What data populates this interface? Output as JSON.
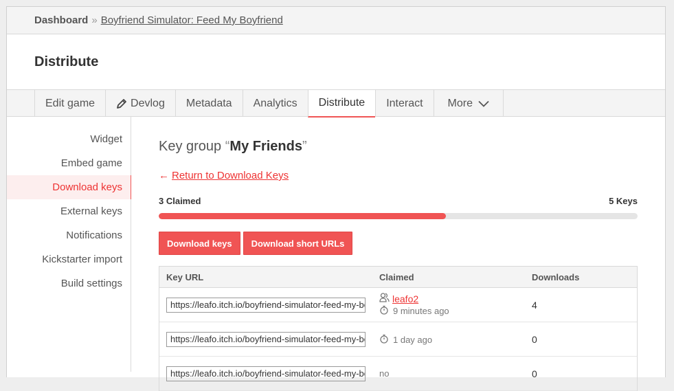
{
  "breadcrumb": {
    "home": "Dashboard",
    "separator": "»",
    "game": "Boyfriend Simulator: Feed My Boyfriend"
  },
  "page_title": "Distribute",
  "tabs": [
    {
      "label": "Edit game"
    },
    {
      "label": "Devlog",
      "icon": "pencil-icon"
    },
    {
      "label": "Metadata"
    },
    {
      "label": "Analytics"
    },
    {
      "label": "Distribute",
      "active": true
    },
    {
      "label": "Interact"
    },
    {
      "label": "More",
      "icon": "chevron-down-icon"
    }
  ],
  "sidebar": {
    "items": [
      {
        "label": "Widget"
      },
      {
        "label": "Embed game"
      },
      {
        "label": "Download keys",
        "active": true
      },
      {
        "label": "External keys"
      },
      {
        "label": "Notifications"
      },
      {
        "label": "Kickstarter import"
      },
      {
        "label": "Build settings"
      }
    ]
  },
  "key_group": {
    "prefix": "Key group",
    "open_quote": "“",
    "name": "My Friends",
    "close_quote": "”",
    "back_arrow": "←",
    "back_link": "Return to Download Keys",
    "claimed_label": "3 Claimed",
    "total_label": "5 Keys",
    "claimed_fraction": 0.6
  },
  "buttons": {
    "download_keys": "Download keys",
    "download_short_urls": "Download short URLs"
  },
  "table": {
    "headers": {
      "key_url": "Key URL",
      "claimed": "Claimed",
      "downloads": "Downloads"
    },
    "rows": [
      {
        "url": "https://leafo.itch.io/boyfriend-simulator-feed-my-boyfriend",
        "user": "leafo2",
        "time": "9 minutes ago",
        "downloads": "4"
      },
      {
        "url": "https://leafo.itch.io/boyfriend-simulator-feed-my-boyfriend",
        "time": "1 day ago",
        "downloads": "0"
      },
      {
        "url": "https://leafo.itch.io/boyfriend-simulator-feed-my-boyfriend",
        "claimed_text": "no",
        "downloads": "0"
      }
    ]
  },
  "colors": {
    "accent": "#f05454",
    "link": "#e33333"
  }
}
